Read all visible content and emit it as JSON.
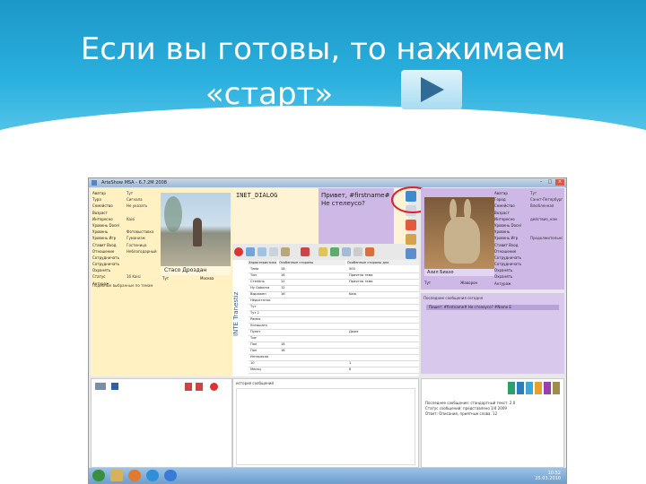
{
  "slide": {
    "title_line1": "Если вы готовы, то нажимаем",
    "title_line2": "«старт»"
  },
  "app": {
    "title": "ArtеShow  MSA - 6.7.2M 2008"
  },
  "left_panel": {
    "props": [
      {
        "k": "Аватар",
        "v": "Тут"
      },
      {
        "k": "Тура",
        "v": "Сигнала"
      },
      {
        "k": "Семейство",
        "v": "Не указать"
      },
      {
        "k": "Возраст",
        "v": ""
      },
      {
        "k": "Интересно",
        "v": "Kaisi"
      },
      {
        "k": "Уровень Docel",
        "v": ""
      },
      {
        "k": "Уровень",
        "v": "Фотовыставка"
      },
      {
        "k": "Уровень Игр",
        "v": "Гуманизм"
      },
      {
        "k": "Ставит Вход",
        "v": "Гостиница"
      },
      {
        "k": "Отношение",
        "v": "Неблагодарный"
      },
      {
        "k": "Сотрудничать",
        "v": ""
      },
      {
        "k": "Сотрудничать",
        "v": ""
      },
      {
        "k": "Охранять",
        "v": ""
      },
      {
        "k": "Статус",
        "v": "16 Kaisi"
      },
      {
        "k": "Антураж",
        "v": ""
      }
    ],
    "name": "Стасо Дроздан",
    "row": {
      "a": "Тут",
      "b": "Москва"
    },
    "hint": "Подобные выбранные по темам"
  },
  "dialog": {
    "id": "INET_DIALOG",
    "message": "Привет, #firstname# Не стелеусо?"
  },
  "right_panel": {
    "props": [
      {
        "k": "Аватар",
        "v": "Тут"
      },
      {
        "k": "Город",
        "v": "Санкт-Петербург"
      },
      {
        "k": "Семейство",
        "v": "Влюбленная"
      },
      {
        "k": "Возраст",
        "v": ""
      },
      {
        "k": "Интересно",
        "v": "действие_нам"
      },
      {
        "k": "Уровень Docel",
        "v": ""
      },
      {
        "k": "Уровень",
        "v": ""
      },
      {
        "k": "Уровень Игр",
        "v": "Продолжительность"
      },
      {
        "k": "Ставит Вход",
        "v": ""
      },
      {
        "k": "Отношение",
        "v": ""
      },
      {
        "k": "Сотрудничать",
        "v": ""
      },
      {
        "k": "Сотрудничать",
        "v": ""
      },
      {
        "k": "Охранять",
        "v": ""
      },
      {
        "k": "Охранять",
        "v": ""
      },
      {
        "k": "Антураж",
        "v": ""
      }
    ],
    "name": "Азил Биазо",
    "row": {
      "a": "Тут",
      "b": "Жаворон"
    },
    "chat_head": "Последние сообщения сегодня",
    "chat_line": "Пишет: #firstname# Не стелеусо? #Name E"
  },
  "grid": {
    "vert_label": "INTE Tranestiz",
    "headers": [
      "Характеристика",
      "Особенные стороны",
      "Особенные стороны дна"
    ],
    "rows": [
      {
        "k": "Тема",
        "a": "18",
        "b": "500"
      },
      {
        "k": "Тип",
        "a": "16",
        "b": "Приятно тема"
      },
      {
        "k": "Степень",
        "a": "12",
        "b": "Приятно тема"
      },
      {
        "k": "Ну Gaborna",
        "a": "12",
        "b": ""
      },
      {
        "k": "Выражен",
        "a": "16",
        "b": "Kaisi"
      },
      {
        "k": "Недостатки",
        "a": "",
        "b": ""
      },
      {
        "k": "Тут",
        "a": "",
        "b": ""
      },
      {
        "k": "Тут 2",
        "a": "",
        "b": ""
      },
      {
        "k": "Рамка",
        "a": "",
        "b": ""
      },
      {
        "k": "Услышать",
        "a": "",
        "b": ""
      },
      {
        "k": "Пунет",
        "a": "",
        "b": "Даже"
      },
      {
        "k": "Тие",
        "a": "",
        "b": ""
      },
      {
        "k": "Пол",
        "a": "18",
        "b": ""
      },
      {
        "k": "Пол",
        "a": "18",
        "b": ""
      },
      {
        "k": "Интересно",
        "a": "",
        "b": ""
      },
      {
        "k": "10",
        "a": "",
        "b": "1"
      },
      {
        "k": "Месяц",
        "a": "",
        "b": "6"
      }
    ]
  },
  "bottom": {
    "mid_head": "история сообщений",
    "log": [
      "Последнее сообщение: стандартный текст. 2.0",
      "Статус сообщений: представлено 1/4 2009",
      "Ответ: Описание, приятные слова. 12"
    ],
    "swatches": [
      "#2aa06a",
      "#2a7ec0",
      "#3aa9d9",
      "#e6a12b",
      "#9b3fb0",
      "#a08d4b"
    ]
  },
  "taskbar": {
    "time": "10:52",
    "date": "25.03.2010"
  },
  "colors": {
    "header_blue": "#1d97c8",
    "left_panel": "#fff1c2",
    "right_panel": "#cdb8e6",
    "red_ring": "#d9202e"
  }
}
